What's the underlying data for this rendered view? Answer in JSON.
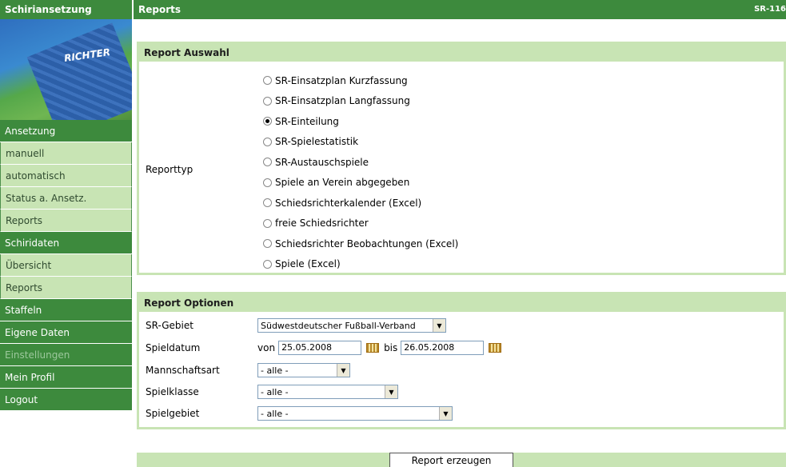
{
  "sidebar": {
    "title": "Schiriansetzung",
    "image_label": "RICHTER",
    "items": [
      {
        "label": "Ansetzung",
        "kind": "head"
      },
      {
        "label": "manuell",
        "kind": "light"
      },
      {
        "label": "automatisch",
        "kind": "light"
      },
      {
        "label": "Status a. Ansetz.",
        "kind": "light"
      },
      {
        "label": "Reports",
        "kind": "light"
      },
      {
        "label": "Schiridaten",
        "kind": "head"
      },
      {
        "label": "Übersicht",
        "kind": "light"
      },
      {
        "label": "Reports",
        "kind": "light"
      },
      {
        "label": "Staffeln",
        "kind": "dark"
      },
      {
        "label": "Eigene Daten",
        "kind": "dark"
      },
      {
        "label": "Einstellungen",
        "kind": "disabled"
      },
      {
        "label": "Mein Profil",
        "kind": "dark"
      },
      {
        "label": "Logout",
        "kind": "dark"
      }
    ]
  },
  "header": {
    "title": "Reports",
    "code": "SR-116"
  },
  "auswahl": {
    "title": "Report Auswahl",
    "reporttyp_label": "Reporttyp",
    "options": [
      {
        "label": "SR-Einsatzplan Kurzfassung",
        "checked": false
      },
      {
        "label": "SR-Einsatzplan Langfassung",
        "checked": false
      },
      {
        "label": "SR-Einteilung",
        "checked": true
      },
      {
        "label": "SR-Spielestatistik",
        "checked": false
      },
      {
        "label": "SR-Austauschspiele",
        "checked": false
      },
      {
        "label": "Spiele an Verein abgegeben",
        "checked": false
      },
      {
        "label": "Schiedsrichterkalender (Excel)",
        "checked": false
      },
      {
        "label": "freie Schiedsrichter",
        "checked": false
      },
      {
        "label": "Schiedsrichter Beobachtungen (Excel)",
        "checked": false
      },
      {
        "label": "Spiele (Excel)",
        "checked": false
      }
    ]
  },
  "optionen": {
    "title": "Report Optionen",
    "sr_gebiet": {
      "label": "SR-Gebiet",
      "value": "Südwestdeutscher Fußball-Verband"
    },
    "spieldatum": {
      "label": "Spieldatum",
      "von": "von",
      "from": "25.05.2008",
      "bis": "bis",
      "to": "26.05.2008"
    },
    "mannschaftsart": {
      "label": "Mannschaftsart",
      "value": "- alle -"
    },
    "spielklasse": {
      "label": "Spielklasse",
      "value": "- alle -"
    },
    "spielgebiet": {
      "label": "Spielgebiet",
      "value": "- alle -"
    }
  },
  "submit_label": "Report erzeugen"
}
